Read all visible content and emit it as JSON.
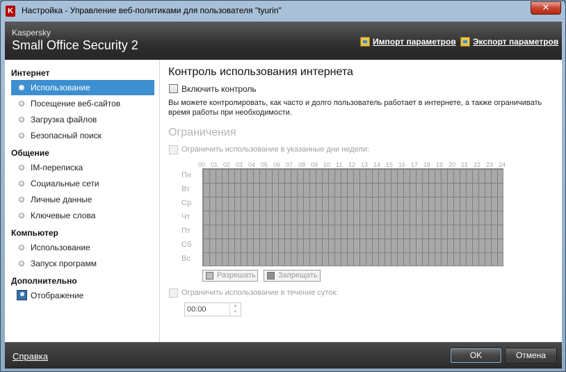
{
  "window": {
    "title": "Настройка - Управление веб-политиками для пользователя \"tyurin\"",
    "close_glyph": "✕"
  },
  "header": {
    "brand_small": "Kaspersky",
    "brand_big": "Small Office Security 2",
    "import_label": "Импорт параметров",
    "export_label": "Экспорт параметров"
  },
  "sidebar": {
    "categories": [
      "Интернет",
      "Общение",
      "Компьютер",
      "Дополнительно"
    ],
    "internet": [
      "Использование",
      "Посещение веб-сайтов",
      "Загрузка файлов",
      "Безопасный поиск"
    ],
    "communication": [
      "IM-переписка",
      "Социальные сети",
      "Личные данные",
      "Ключевые слова"
    ],
    "computer": [
      "Использование",
      "Запуск программ"
    ],
    "extra": [
      "Отображение"
    ],
    "selected": "Использование"
  },
  "main": {
    "title": "Контроль использования интернета",
    "enable_label": "Включить контроль",
    "enable_checked": false,
    "description": "Вы можете контролировать, как часто и долго пользователь работает в интернете, а также ограничивать время работы при необходимости.",
    "limits_title": "Ограничения",
    "limit_days_label": "Ограничить использование в указанные дни недели:",
    "hours": [
      "00",
      "01",
      "02",
      "03",
      "04",
      "05",
      "06",
      "07",
      "08",
      "09",
      "10",
      "11",
      "12",
      "13",
      "14",
      "15",
      "16",
      "17",
      "18",
      "19",
      "20",
      "21",
      "22",
      "23",
      "24"
    ],
    "days": [
      "Пн",
      "Вт",
      "Ср",
      "Чт",
      "Пт",
      "Сб",
      "Вс"
    ],
    "allow_label": "Разрешать",
    "allow_color": "#bdbdbd",
    "deny_label": "Запрещать",
    "deny_color": "#8f8f8f",
    "limit_daily_label": "Ограничить использование в течение суток:",
    "daily_time": "00:00"
  },
  "footer": {
    "help_label": "Справка",
    "ok_label": "OK",
    "cancel_label": "Отмена"
  }
}
